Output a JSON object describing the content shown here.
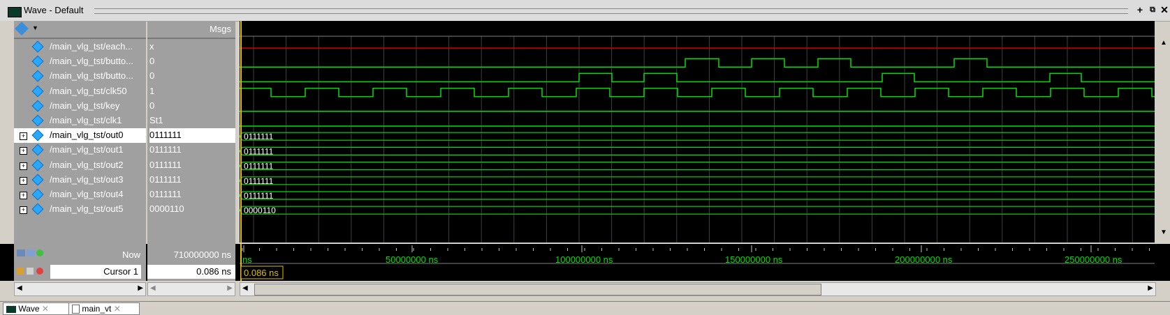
{
  "window": {
    "title": "Wave - Default"
  },
  "columns": {
    "msgs_label": "Msgs"
  },
  "signals": [
    {
      "name": "/main_vlg_tst/each...",
      "value": "x",
      "expandable": false
    },
    {
      "name": "/main_vlg_tst/butto...",
      "value": "0",
      "expandable": false
    },
    {
      "name": "/main_vlg_tst/butto...",
      "value": "0",
      "expandable": false
    },
    {
      "name": "/main_vlg_tst/clk50",
      "value": "1",
      "expandable": false
    },
    {
      "name": "/main_vlg_tst/key",
      "value": "0",
      "expandable": false
    },
    {
      "name": "/main_vlg_tst/clk1",
      "value": "St1",
      "expandable": false
    },
    {
      "name": "/main_vlg_tst/out0",
      "value": "0111111",
      "expandable": true,
      "selected": true
    },
    {
      "name": "/main_vlg_tst/out1",
      "value": "0111111",
      "expandable": true
    },
    {
      "name": "/main_vlg_tst/out2",
      "value": "0111111",
      "expandable": true
    },
    {
      "name": "/main_vlg_tst/out3",
      "value": "0111111",
      "expandable": true
    },
    {
      "name": "/main_vlg_tst/out4",
      "value": "0111111",
      "expandable": true
    },
    {
      "name": "/main_vlg_tst/out5",
      "value": "0000110",
      "expandable": true
    }
  ],
  "bus_labels": [
    "0111111",
    "0111111",
    "0111111",
    "0111111",
    "0111111",
    "0000110"
  ],
  "status": {
    "now_label": "Now",
    "now_value": "710000000 ns",
    "cursor_label": "Cursor 1",
    "cursor_value": "0.086 ns",
    "cursor_marker": "0.086 ns"
  },
  "timeline": {
    "ticks": [
      "ns",
      "50000000 ns",
      "100000000 ns",
      "150000000 ns",
      "200000000 ns",
      "250000000 ns"
    ]
  },
  "tabs": [
    {
      "label": "Wave",
      "icon": "wave-icon"
    },
    {
      "label": "main_vt",
      "icon": "document-icon"
    }
  ],
  "colors": {
    "wave_green": "#00e000",
    "undefined_red": "#d00000",
    "cursor_yellow": "#e0c000",
    "grid": "#404040"
  }
}
